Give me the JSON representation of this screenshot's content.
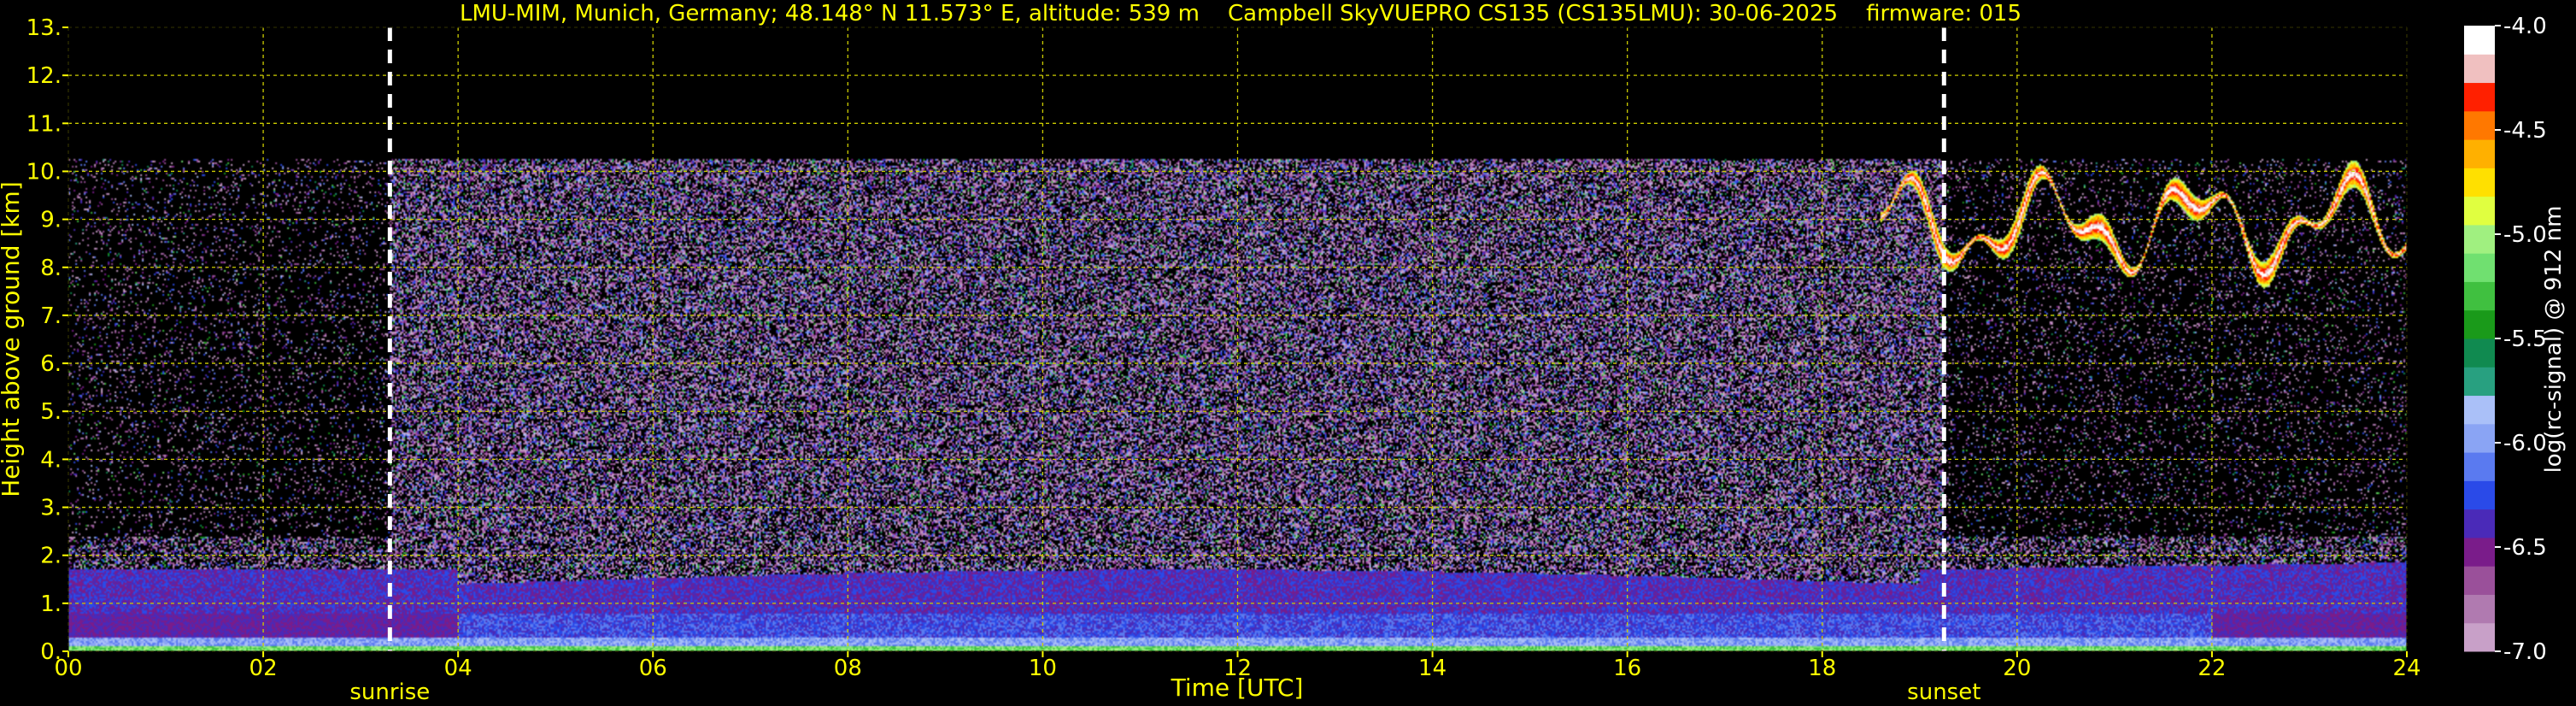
{
  "chart_data": {
    "type": "heatmap",
    "title": "LMU-MIM, Munich, Germany; 48.148° N 11.573° E, altitude: 539 m    Campbell SkyVUEPRO CS135 (CS135LMU): 30-06-2025    firmware: 015",
    "xlabel": "Time [UTC]",
    "ylabel": "Height above ground [km]",
    "colorbar_label": "log(rc-signal) @ 912 nm",
    "xlim": [
      0,
      24
    ],
    "ylim": [
      0,
      13
    ],
    "x_ticks": [
      0,
      2,
      4,
      6,
      8,
      10,
      12,
      14,
      16,
      18,
      20,
      22,
      24
    ],
    "x_tick_labels": [
      "00",
      "02",
      "04",
      "06",
      "08",
      "10",
      "12",
      "14",
      "16",
      "18",
      "20",
      "22",
      "24"
    ],
    "y_ticks": [
      0,
      1,
      2,
      3,
      4,
      5,
      6,
      7,
      8,
      9,
      10,
      11,
      12,
      13
    ],
    "y_tick_labels": [
      "0.",
      "1.",
      "2.",
      "3.",
      "4.",
      "5.",
      "6.",
      "7.",
      "8.",
      "9.",
      "10.",
      "11.",
      "12.",
      "13."
    ],
    "colorbar_range": [
      -7.0,
      -4.0
    ],
    "colorbar_ticks": [
      -4.0,
      -4.5,
      -5.0,
      -5.5,
      -6.0,
      -6.5,
      -7.0
    ],
    "colorbar_tick_labels": [
      "-4.0",
      "-4.5",
      "-5.0",
      "-5.5",
      "-6.0",
      "-6.5",
      "-7.0"
    ],
    "grid": true,
    "signal_top_km": 10.25,
    "markers": [
      {
        "label": "sunrise",
        "x": 3.3
      },
      {
        "label": "sunset",
        "x": 19.25
      }
    ],
    "colors": {
      "text": "#ffff00",
      "grid": "#cccc00",
      "background": "#000000",
      "colormap": [
        "#c8a0c8",
        "#b07ab0",
        "#9a509a",
        "#7a1c8a",
        "#4a2ab8",
        "#2a4ae8",
        "#5a7af0",
        "#8aa4f4",
        "#aac0f8",
        "#28a080",
        "#108a50",
        "#1a9a1a",
        "#40c040",
        "#70e070",
        "#a0f080",
        "#e0ff40",
        "#ffe000",
        "#ffb000",
        "#ff7800",
        "#ff2000",
        "#f0c0c0",
        "#ffffff"
      ]
    }
  }
}
